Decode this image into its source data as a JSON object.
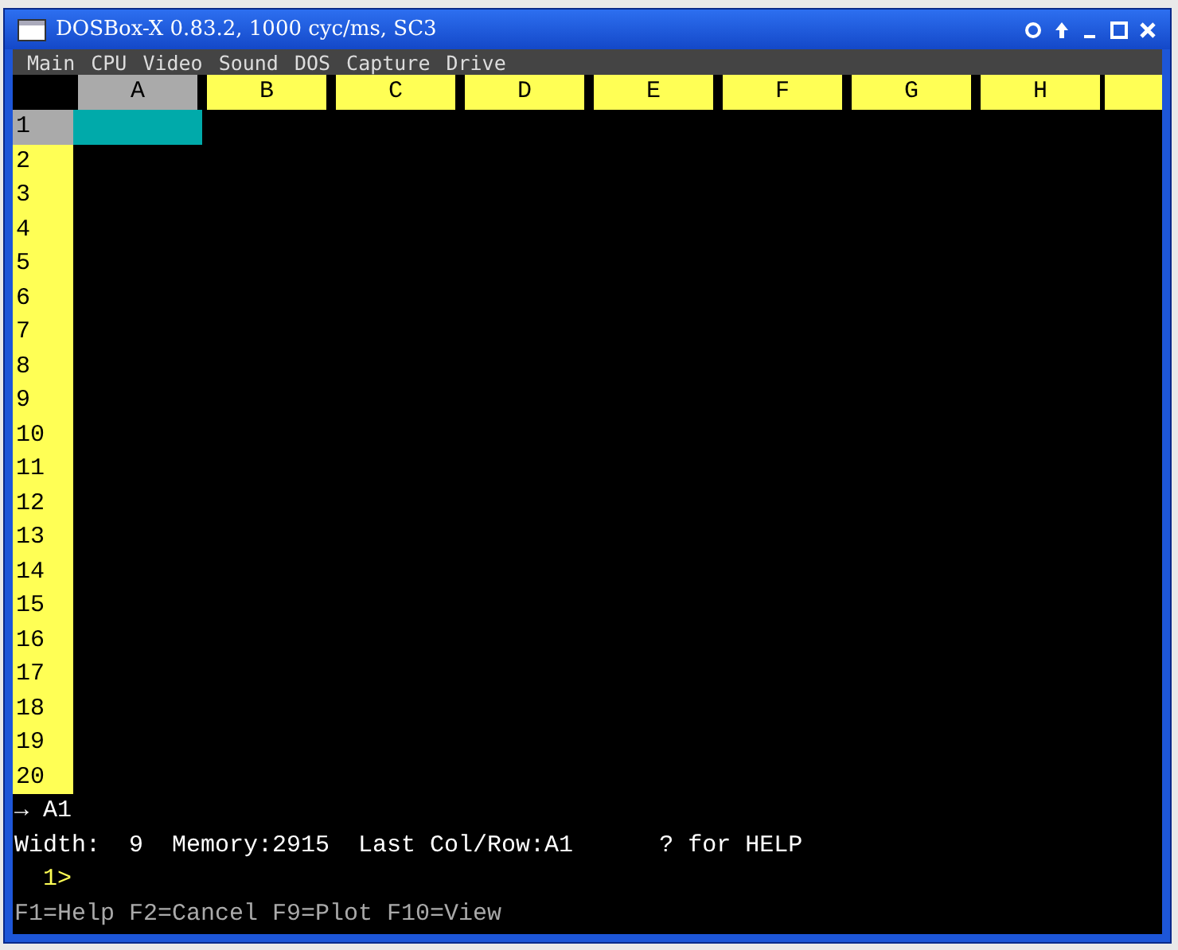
{
  "window": {
    "title": "DOSBox-X 0.83.2, 1000 cyc/ms, SC3"
  },
  "menu": [
    "Main",
    "CPU",
    "Video",
    "Sound",
    "DOS",
    "Capture",
    "Drive"
  ],
  "columns": [
    {
      "label": "A",
      "selected": true
    },
    {
      "label": "B",
      "selected": false
    },
    {
      "label": "C",
      "selected": false
    },
    {
      "label": "D",
      "selected": false
    },
    {
      "label": "E",
      "selected": false
    },
    {
      "label": "F",
      "selected": false
    },
    {
      "label": "G",
      "selected": false
    },
    {
      "label": "H",
      "selected": false
    }
  ],
  "rows": [
    {
      "label": "1",
      "selected": true
    },
    {
      "label": "2",
      "selected": false
    },
    {
      "label": "3",
      "selected": false
    },
    {
      "label": "4",
      "selected": false
    },
    {
      "label": "5",
      "selected": false
    },
    {
      "label": "6",
      "selected": false
    },
    {
      "label": "7",
      "selected": false
    },
    {
      "label": "8",
      "selected": false
    },
    {
      "label": "9",
      "selected": false
    },
    {
      "label": "10",
      "selected": false
    },
    {
      "label": "11",
      "selected": false
    },
    {
      "label": "12",
      "selected": false
    },
    {
      "label": "13",
      "selected": false
    },
    {
      "label": "14",
      "selected": false
    },
    {
      "label": "15",
      "selected": false
    },
    {
      "label": "16",
      "selected": false
    },
    {
      "label": "17",
      "selected": false
    },
    {
      "label": "18",
      "selected": false
    },
    {
      "label": "19",
      "selected": false
    },
    {
      "label": "20",
      "selected": false
    }
  ],
  "current_cell": "→ A1",
  "status_line": "Width:  9  Memory:2915  Last Col/Row:A1      ? for HELP",
  "prompt": "1>",
  "function_keys": "F1=Help F2=Cancel F9=Plot F10=View"
}
